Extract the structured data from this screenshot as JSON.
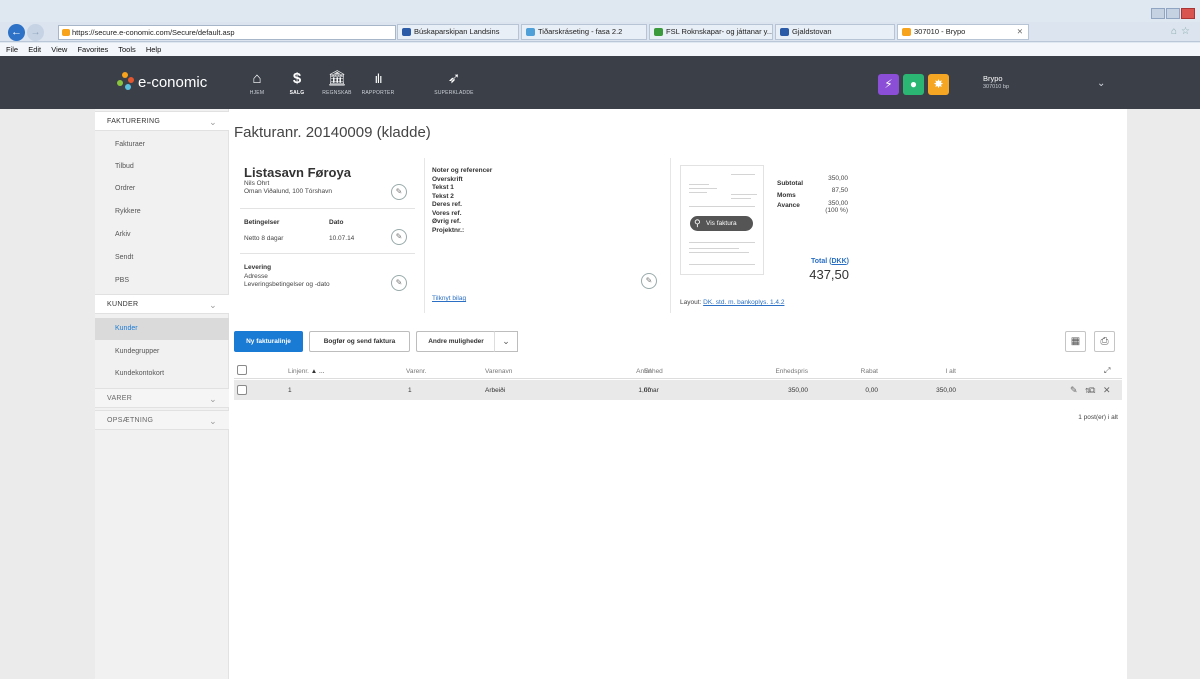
{
  "browser": {
    "address": "https://secure.e-conomic.com/Secure/default.asp",
    "address_tools": "⌕ ▾ 🔒 ↻ ✕",
    "tabs": [
      {
        "label": "Búskaparskipan Landsins",
        "color": "#2b5aa6"
      },
      {
        "label": "Tiðarskráseting - fasa 2.2",
        "color": "#4f9fd9"
      },
      {
        "label": "FSL Roknskapar- og játtanar y...",
        "color": "#3b9a3b"
      },
      {
        "label": "Gjaldstovan",
        "color": "#2b5aa6"
      },
      {
        "label": "307010 - Brypo",
        "color": "#f7a31c"
      }
    ],
    "menu": [
      "File",
      "Edit",
      "View",
      "Favorites",
      "Tools",
      "Help"
    ]
  },
  "app": {
    "logo_text": "e-conomic",
    "nav": [
      {
        "label": "HJEM",
        "icon": "home-icon"
      },
      {
        "label": "SALG",
        "icon": "dollar-icon"
      },
      {
        "label": "REGNSKAB",
        "icon": "bank-icon"
      },
      {
        "label": "RAPPORTER",
        "icon": "bar-chart-icon"
      },
      {
        "label": "SUPERKLADDE",
        "icon": "rocket-icon"
      }
    ],
    "user_name": "Brypo",
    "user_sub": "307010 bp",
    "colors": {
      "header": "#3a3f48",
      "accent": "#1a7bd5",
      "lightning": "#8a4fd6",
      "help": "#2bb673",
      "settings": "#f5a623"
    }
  },
  "sidebar": {
    "sections": [
      {
        "label": "FAKTURERING",
        "items": [
          "Fakturaer",
          "Tilbud",
          "Ordrer",
          "Rykkere",
          "Arkiv",
          "Sendt",
          "PBS"
        ]
      },
      {
        "label": "KUNDER",
        "items": [
          "Kunder",
          "Kundegrupper",
          "Kundekontokort"
        ]
      },
      {
        "label": "VARER",
        "items": []
      },
      {
        "label": "OPSÆTNING",
        "items": []
      }
    ]
  },
  "invoice": {
    "title": "Fakturanr. 20140009 (kladde)",
    "customer_name": "Listasavn Føroya",
    "contact": "Nils Ohrt",
    "address": "Oman Viðalund, 100 Tórshavn",
    "terms_label": "Betingelser",
    "terms_value": "Netto 8 dagar",
    "date_label": "Dato",
    "date_value": "10.07.14",
    "delivery_label": "Levering",
    "delivery_address": "Adresse",
    "delivery_terms": "Leveringsbetingelser og -dato",
    "notes": [
      "Noter og referencer",
      "Overskrift",
      "Tekst 1",
      "Tekst 2",
      "Deres ref.",
      "Vores ref.",
      "Øvrig ref.",
      "Projektnr.:"
    ],
    "attach_link": "Tilknyt bilag",
    "vis_faktura": "Vis faktura",
    "subtotal_label": "Subtotal",
    "subtotal_value": "350,00",
    "moms_label": "Moms",
    "moms_value": "87,50",
    "avance_label": "Avance",
    "avance_value": "350,00",
    "avance_pct": "(100 %)",
    "total_label_prefix": "Total (",
    "total_currency": "DKK",
    "total_label_suffix": ")",
    "total_value": "437,50",
    "layout_label": "Layout:",
    "layout_value": "DK. std. m. bankoplys. 1.4.2"
  },
  "toolbar": {
    "new_line": "Ny fakturalinje",
    "book_send": "Bogfør og send faktura",
    "more": "Andre muligheder"
  },
  "table": {
    "headers": {
      "line": "Linjenr.",
      "sort": "▲ ...",
      "varenr": "Varenr.",
      "varenavn": "Varenavn",
      "antal": "Antal",
      "enhed": "Enhed",
      "enhedspris": "Enhedspris",
      "rabat": "Rabat",
      "ialt": "I alt"
    },
    "rows": [
      {
        "line": "1",
        "varenr": "1",
        "varenavn": "Arbeiði",
        "antal": "1,00",
        "enhed": "tímar",
        "enhedspris": "350,00",
        "rabat": "0,00",
        "ialt": "350,00"
      }
    ],
    "footer": "1 post(er) i alt"
  }
}
